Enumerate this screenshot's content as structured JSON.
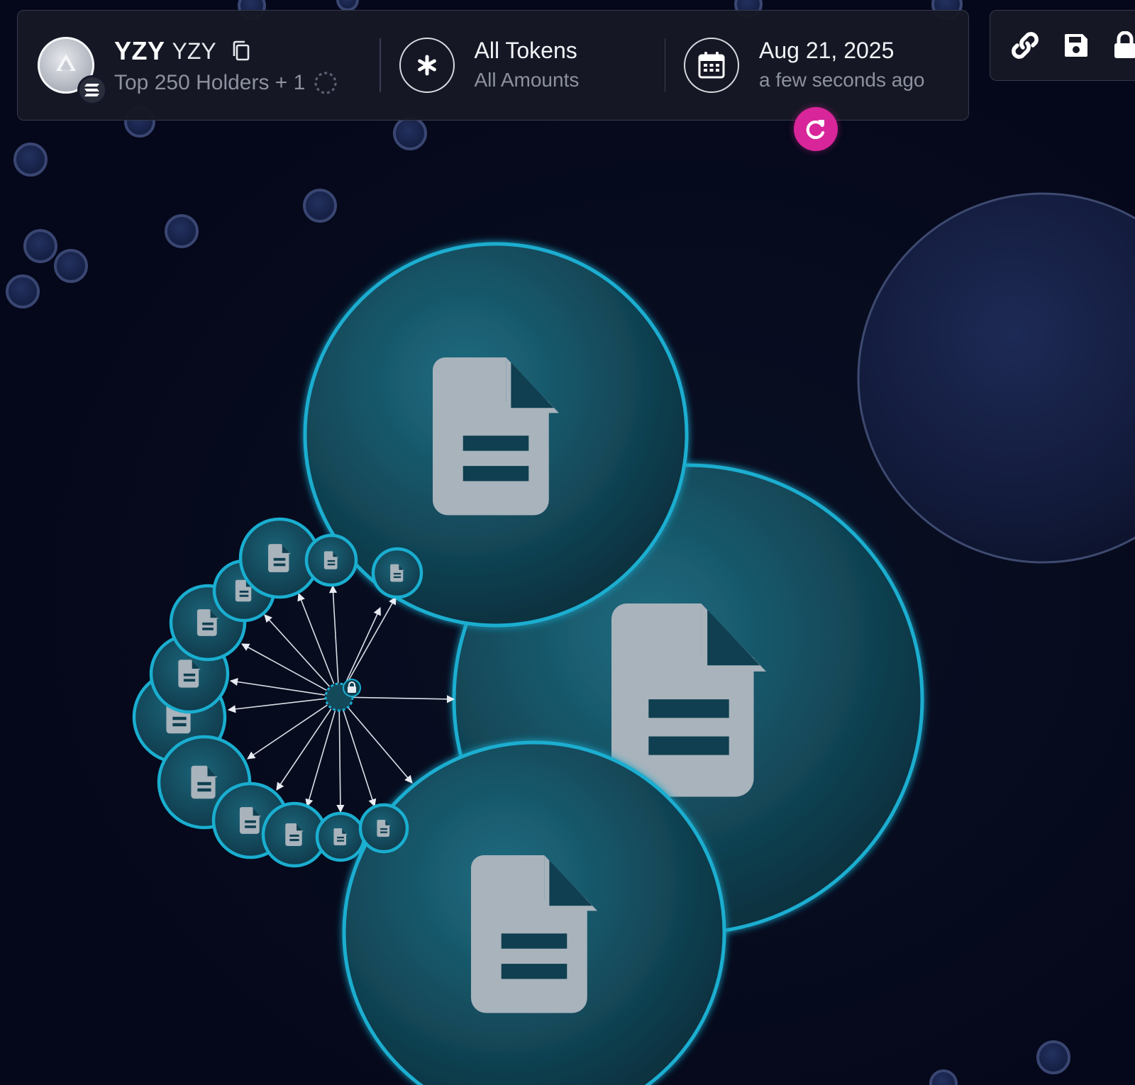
{
  "token": {
    "symbol": "YZY",
    "name": "YZY",
    "holders_label": "Top 250 Holders + 1",
    "logo_icon": "token-logo-icon",
    "chain_icon": "solana-chain-icon"
  },
  "filters": {
    "tokens_label": "All Tokens",
    "amounts_label": "All Amounts",
    "icon": "asterisk-icon"
  },
  "snapshot": {
    "date": "Aug 21, 2025",
    "relative_time": "a few seconds ago",
    "icon": "calendar-icon"
  },
  "actions": {
    "refresh_icon": "refresh-icon",
    "toolbar_icons": [
      "link-icon",
      "save-icon",
      "lock-icon"
    ]
  },
  "colors": {
    "background": "#05081a",
    "bubble_fill": "#12495a",
    "bubble_stroke": "#18a9c9",
    "refresh_accent": "#d8259a",
    "small_dot": "#1c2957"
  },
  "map": {
    "node_icon": "contract-document-icon",
    "hub_icon": "lock-icon",
    "large_nodes": 3,
    "cluster_nodes": 15,
    "background_dots": 17
  }
}
